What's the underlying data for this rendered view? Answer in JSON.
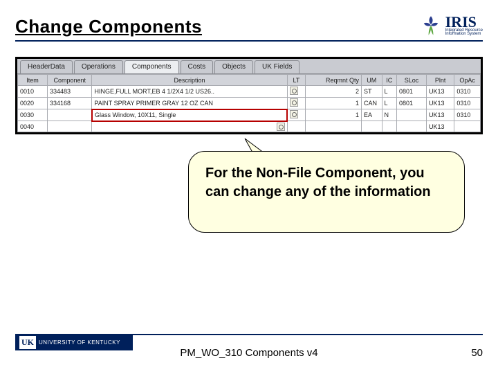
{
  "header": {
    "title": "Change Components",
    "logo": {
      "name": "IRIS",
      "sub1": "Integrated Resource",
      "sub2": "Information System"
    }
  },
  "tabs": {
    "t0": "HeaderData",
    "t1": "Operations",
    "t2": "Components",
    "t3": "Costs",
    "t4": "Objects",
    "t5": "UK Fields"
  },
  "cols": {
    "item": "Item",
    "comp": "Component",
    "desc": "Description",
    "lt": "LT",
    "qty": "Reqmnt Qty",
    "um": "UM",
    "ic": "IC",
    "sloc": "SLoc",
    "plnt": "Plnt",
    "opac": "OpAc"
  },
  "rows": [
    {
      "item": "0010",
      "comp": "334483",
      "desc": "HINGE,FULL MORT,EB 4 1/2X4 1/2 US26..",
      "lt": "",
      "qty": "2",
      "um": "ST",
      "ic": "L",
      "sloc": "0801",
      "plnt": "UK13",
      "opac": "0310"
    },
    {
      "item": "0020",
      "comp": "334168",
      "desc": "PAINT SPRAY PRIMER GRAY 12 OZ CAN",
      "lt": "",
      "qty": "1",
      "um": "CAN",
      "ic": "L",
      "sloc": "0801",
      "plnt": "UK13",
      "opac": "0310"
    },
    {
      "item": "0030",
      "comp": "",
      "desc": "Glass Window, 10X11, Single",
      "lt": "",
      "qty": "1",
      "um": "EA",
      "ic": "N",
      "sloc": "",
      "plnt": "UK13",
      "opac": "0310"
    },
    {
      "item": "0040",
      "comp": "",
      "desc": "",
      "lt": "",
      "qty": "",
      "um": "",
      "ic": "",
      "sloc": "",
      "plnt": "UK13",
      "opac": ""
    }
  ],
  "callout": {
    "text": "For the Non-File Component, you can change any of the information"
  },
  "footer": {
    "uk": "UNIVERSITY OF KENTUCKY",
    "center": "PM_WO_310 Components v4",
    "page": "50"
  }
}
